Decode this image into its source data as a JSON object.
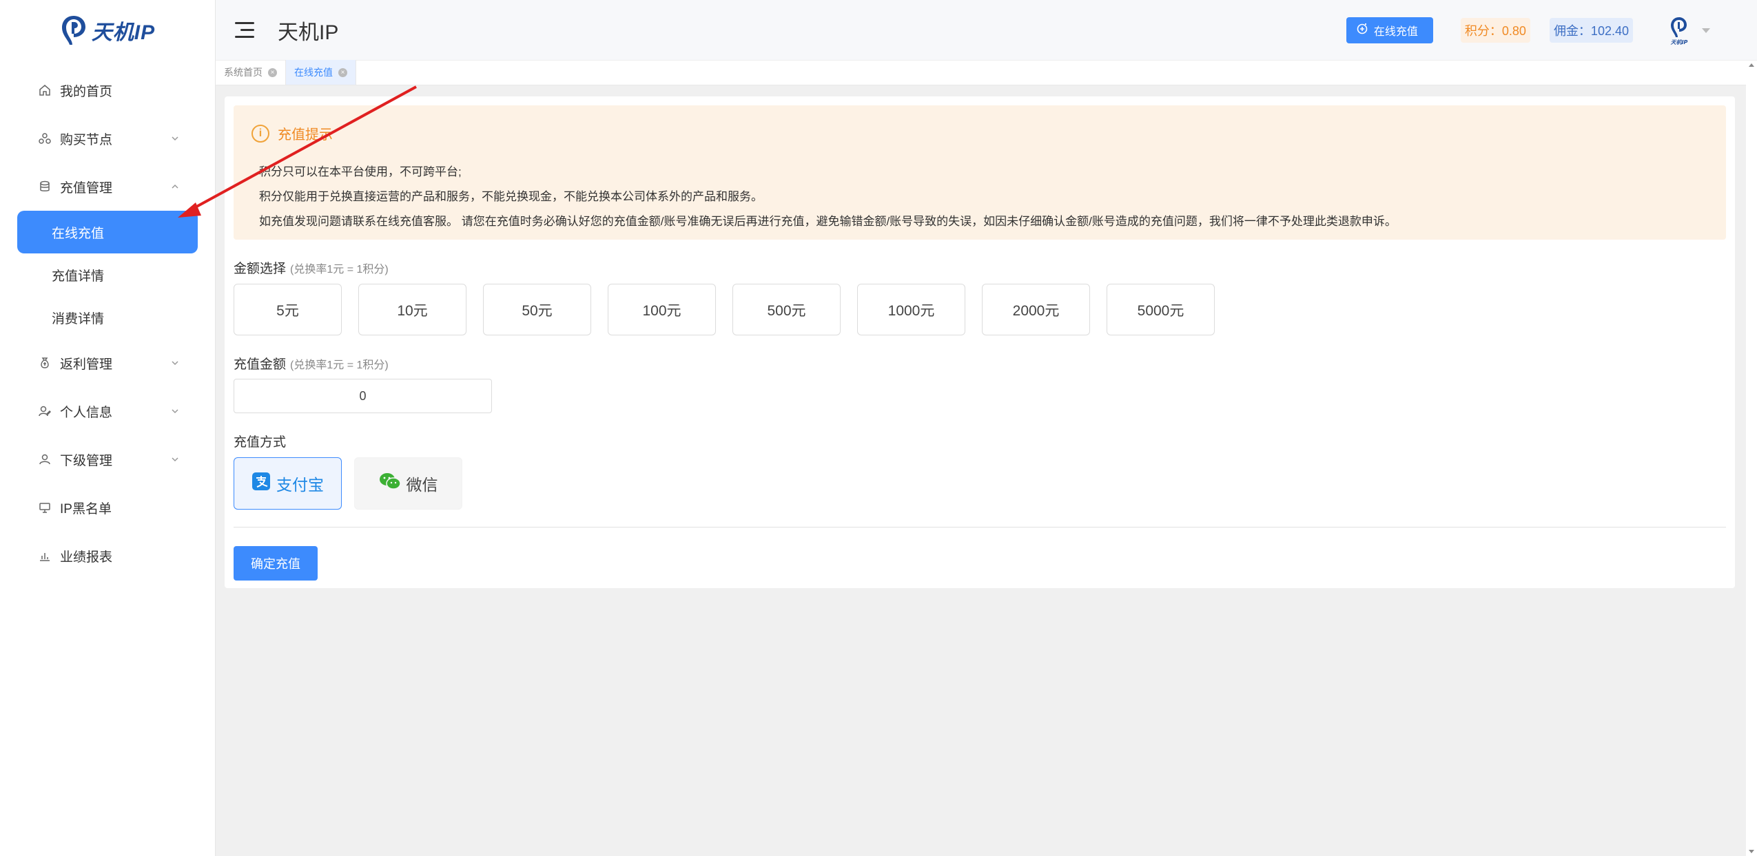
{
  "brand": {
    "logo_text": "天机IP",
    "color": "#1f4e9c"
  },
  "sidebar": {
    "items": [
      {
        "label": "我的首页",
        "icon": "home-icon"
      },
      {
        "label": "购买节点",
        "icon": "nodes-icon"
      },
      {
        "label": "充值管理",
        "icon": "database-icon",
        "expanded": true
      },
      {
        "label": "返利管理",
        "icon": "money-bag-icon"
      },
      {
        "label": "个人信息",
        "icon": "user-edit-icon"
      },
      {
        "label": "下级管理",
        "icon": "user-icon"
      },
      {
        "label": "IP黑名单",
        "icon": "monitor-icon"
      },
      {
        "label": "业绩报表",
        "icon": "bar-chart-icon"
      }
    ],
    "sub_items": [
      {
        "label": "在线充值",
        "active": true
      },
      {
        "label": "充值详情"
      },
      {
        "label": "消费详情"
      }
    ]
  },
  "header": {
    "title": "天机IP",
    "recharge_button": "在线充值",
    "points": "积分：0.80",
    "commission": "佣金：102.40"
  },
  "tabs": [
    {
      "label": "系统首页",
      "active": false
    },
    {
      "label": "在线充值",
      "active": true
    }
  ],
  "notice": {
    "title": "充值提示",
    "lines": [
      "积分只可以在本平台使用，不可跨平台;",
      "积分仅能用于兑换直接运营的产品和服务，不能兑换现金，不能兑换本公司体系外的产品和服务。",
      "如充值发现问题请联系在线充值客服。 请您在充值时务必确认好您的充值金额/账号准确无误后再进行充值，避免输错金额/账号导致的失误，如因未仔细确认金额/账号造成的充值问题，我们将一律不予处理此类退款申诉。"
    ]
  },
  "amount_select": {
    "label": "金额选择",
    "hint": "(兑换率1元 = 1积分)",
    "options": [
      "5元",
      "10元",
      "50元",
      "100元",
      "500元",
      "1000元",
      "2000元",
      "5000元"
    ]
  },
  "amount_input": {
    "label": "充值金额",
    "hint": "(兑换率1元 = 1积分)",
    "value": "0"
  },
  "payment": {
    "label": "充值方式",
    "options": [
      {
        "label": "支付宝",
        "icon": "alipay-icon",
        "selected": true
      },
      {
        "label": "微信",
        "icon": "wechat-icon",
        "selected": false
      }
    ]
  },
  "confirm_button": "确定充值",
  "colors": {
    "primary": "#3d8bfd",
    "warning": "#f08a24",
    "notice_bg": "#fdf2e5",
    "annotation": "#e02020"
  }
}
